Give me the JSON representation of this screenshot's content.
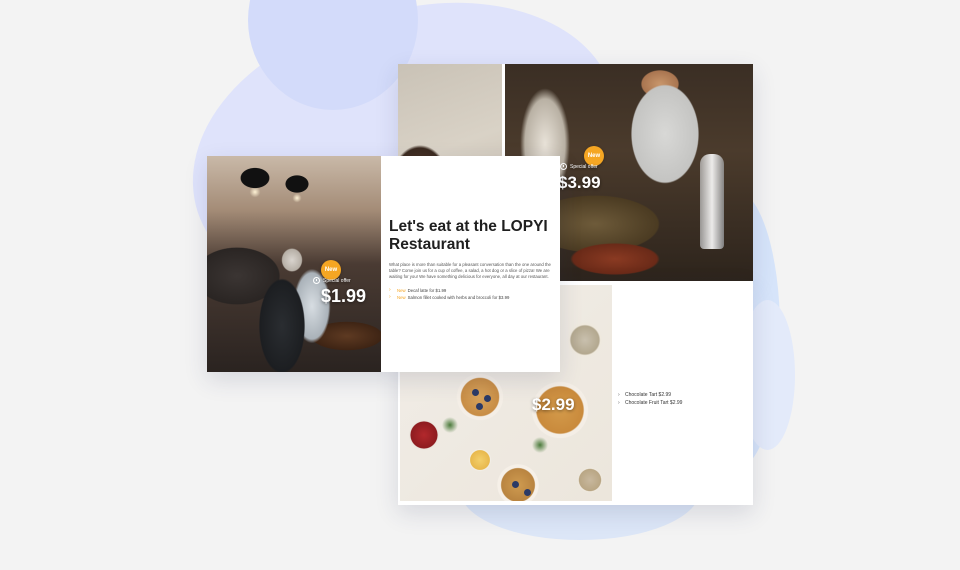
{
  "top_card": {
    "badge": "New",
    "tag": "Special offer",
    "price": "$3.99"
  },
  "front_card": {
    "badge": "New",
    "tag": "Special offer",
    "price": "$1.99",
    "title": "Let's eat at the LOPYI Restaurant",
    "body": "What place is more than suitable for a pleasant conversation than the one around the table? Come join us for a cup of coffee, a salad, a hot dog or a slice of pizza! We are waiting for you! We have something delicious for everyone, all day at our restaurant.",
    "menu": [
      {
        "tag": "New",
        "text": "Decaf latte for $1.99"
      },
      {
        "tag": "New",
        "text": "Salmon fillet cooked with herbs and broccoli for $3.99"
      }
    ]
  },
  "bottom_card": {
    "price": "$2.99",
    "list": [
      {
        "text": "Chocolate Tart $2.99"
      },
      {
        "text": "Chocolate Fruit Tart $2.99"
      }
    ]
  },
  "colors": {
    "accent": "#f5a623",
    "background": "#f3f3f3",
    "blob": "#dfe3fb"
  },
  "icons": [
    "clock-icon",
    "arrow-right-icon"
  ]
}
